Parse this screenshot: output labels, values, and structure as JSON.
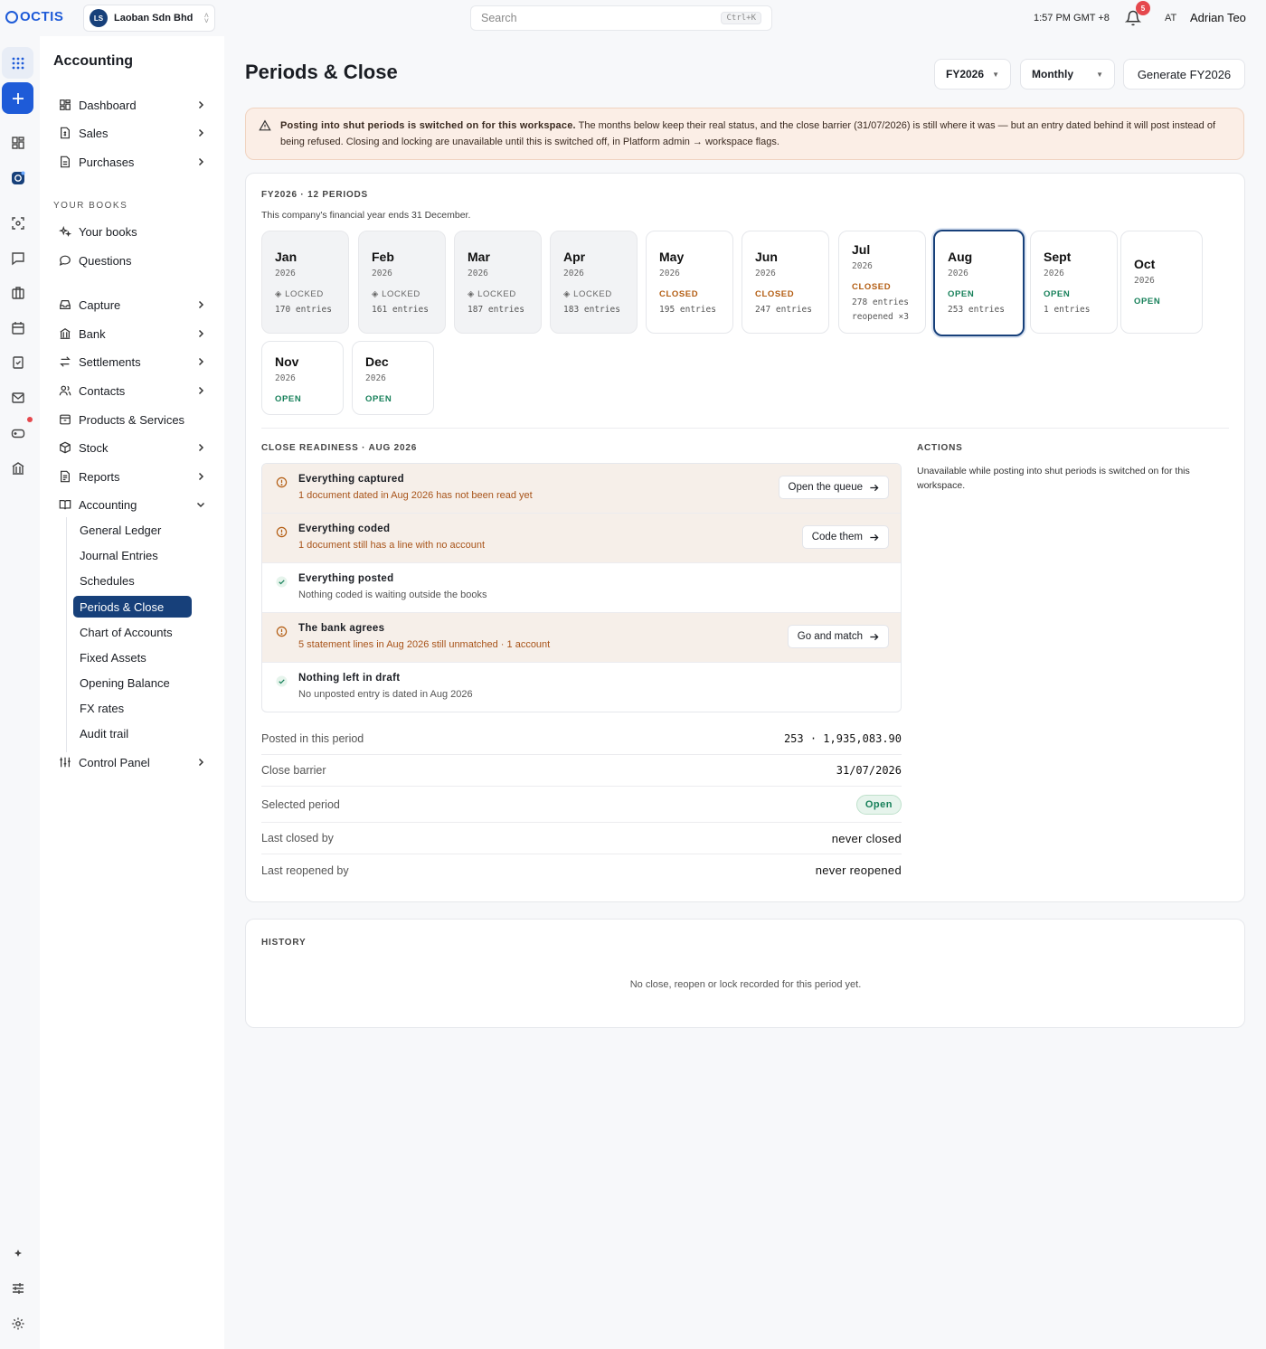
{
  "topbar": {
    "logo": "OCTIS",
    "org_initials": "LS",
    "org_name": "Laoban Sdn Bhd",
    "search_placeholder": "Search",
    "search_shortcut": "Ctrl+K",
    "clock": "1:57 PM GMT +8",
    "notifications_count": "5",
    "user_initials": "AT",
    "user_name": "Adrian Teo"
  },
  "sidebar": {
    "title": "Accounting",
    "top_items": [
      {
        "label": "Dashboard",
        "icon": "dashboard-icon"
      },
      {
        "label": "Sales",
        "icon": "sales-icon"
      },
      {
        "label": "Purchases",
        "icon": "purchases-icon"
      }
    ],
    "section_label": "YOUR BOOKS",
    "book_items": [
      {
        "label": "Your books",
        "icon": "sparkle-icon"
      },
      {
        "label": "Questions",
        "icon": "chat-bubble-icon"
      }
    ],
    "main_items": [
      {
        "label": "Capture",
        "icon": "inbox-icon"
      },
      {
        "label": "Bank",
        "icon": "bank-icon"
      },
      {
        "label": "Settlements",
        "icon": "swap-icon"
      },
      {
        "label": "Contacts",
        "icon": "contacts-icon"
      },
      {
        "label": "Products & Services",
        "icon": "box-icon"
      },
      {
        "label": "Stock",
        "icon": "cube-icon"
      },
      {
        "label": "Reports",
        "icon": "report-icon"
      },
      {
        "label": "Accounting",
        "icon": "book-icon"
      }
    ],
    "accounting_sub": [
      "General Ledger",
      "Journal Entries",
      "Schedules",
      "Periods & Close",
      "Chart of Accounts",
      "Fixed Assets",
      "Opening Balance",
      "FX rates",
      "Audit trail"
    ],
    "active_sub": "Periods & Close",
    "bottom_item": {
      "label": "Control Panel",
      "icon": "sliders-icon"
    }
  },
  "header": {
    "title": "Periods & Close",
    "fy_select": "FY2026",
    "granularity_select": "Monthly",
    "generate_button": "Generate FY2026"
  },
  "warning": {
    "bold": "Posting into shut periods is switched on for this workspace.",
    "text": " The months below keep their real status, and the close barrier (31/07/2026) is still where it was — but an entry dated behind it will post instead of being refused. Closing and locking are unavailable until this is switched off, in Platform admin → workspace flags."
  },
  "periods": {
    "title": "FY2026 · 12 PERIODS",
    "subtitle": "This company's financial year ends 31 December.",
    "months": [
      {
        "name": "Jan",
        "year": "2026",
        "status": "◈ LOCKED",
        "kind": "locked",
        "entries": "170 entries",
        "note": ""
      },
      {
        "name": "Feb",
        "year": "2026",
        "status": "◈ LOCKED",
        "kind": "locked",
        "entries": "161 entries",
        "note": ""
      },
      {
        "name": "Mar",
        "year": "2026",
        "status": "◈ LOCKED",
        "kind": "locked",
        "entries": "187 entries",
        "note": ""
      },
      {
        "name": "Apr",
        "year": "2026",
        "status": "◈ LOCKED",
        "kind": "locked",
        "entries": "183 entries",
        "note": ""
      },
      {
        "name": "May",
        "year": "2026",
        "status": "CLOSED",
        "kind": "closed",
        "entries": "195 entries",
        "note": ""
      },
      {
        "name": "Jun",
        "year": "2026",
        "status": "CLOSED",
        "kind": "closed",
        "entries": "247 entries",
        "note": ""
      },
      {
        "name": "Jul",
        "year": "2026",
        "status": "CLOSED",
        "kind": "closed",
        "entries": "278 entries",
        "note": "reopened ×3"
      },
      {
        "name": "Aug",
        "year": "2026",
        "status": "OPEN",
        "kind": "open",
        "entries": "253 entries",
        "note": ""
      },
      {
        "name": "Sept",
        "year": "2026",
        "status": "OPEN",
        "kind": "open",
        "entries": "1 entries",
        "note": ""
      },
      {
        "name": "Oct",
        "year": "2026",
        "status": "OPEN",
        "kind": "open",
        "entries": "",
        "note": ""
      },
      {
        "name": "Nov",
        "year": "2026",
        "status": "OPEN",
        "kind": "open",
        "entries": "",
        "note": ""
      },
      {
        "name": "Dec",
        "year": "2026",
        "status": "OPEN",
        "kind": "open",
        "entries": "",
        "note": ""
      }
    ],
    "selected": "Aug"
  },
  "readiness": {
    "title": "CLOSE READINESS · AUG 2026",
    "checks": [
      {
        "title": "Everything captured",
        "detail": "1 document dated in Aug 2026 has not been read yet",
        "state": "pending",
        "action": "Open the queue"
      },
      {
        "title": "Everything coded",
        "detail": "1 document still has a line with no account",
        "state": "pending",
        "action": "Code them"
      },
      {
        "title": "Everything posted",
        "detail": "Nothing coded is waiting outside the books",
        "state": "done",
        "action": ""
      },
      {
        "title": "The bank agrees",
        "detail": "5 statement lines in Aug 2026 still unmatched · 1 account",
        "state": "pending",
        "action": "Go and match"
      },
      {
        "title": "Nothing left in draft",
        "detail": "No unposted entry is dated in Aug 2026",
        "state": "done",
        "action": ""
      }
    ]
  },
  "actions": {
    "title": "ACTIONS",
    "text": "Unavailable while posting into shut periods is switched on for this workspace."
  },
  "summary": {
    "posted_label": "Posted in this period",
    "posted_value": "253 · 1,935,083.90",
    "barrier_label": "Close barrier",
    "barrier_value": "31/07/2026",
    "selected_label": "Selected period",
    "selected_value": "Open",
    "last_closed_label": "Last closed by",
    "last_closed_value": "never closed",
    "last_reopened_label": "Last reopened by",
    "last_reopened_value": "never reopened"
  },
  "history": {
    "title": "HISTORY",
    "empty": "No close, reopen or lock recorded for this period yet."
  },
  "colors": {
    "brand": "#17407a",
    "accent": "#1e5bd8",
    "closed": "#b35d12",
    "open": "#17805a",
    "warning_bg": "#fbeee6"
  }
}
